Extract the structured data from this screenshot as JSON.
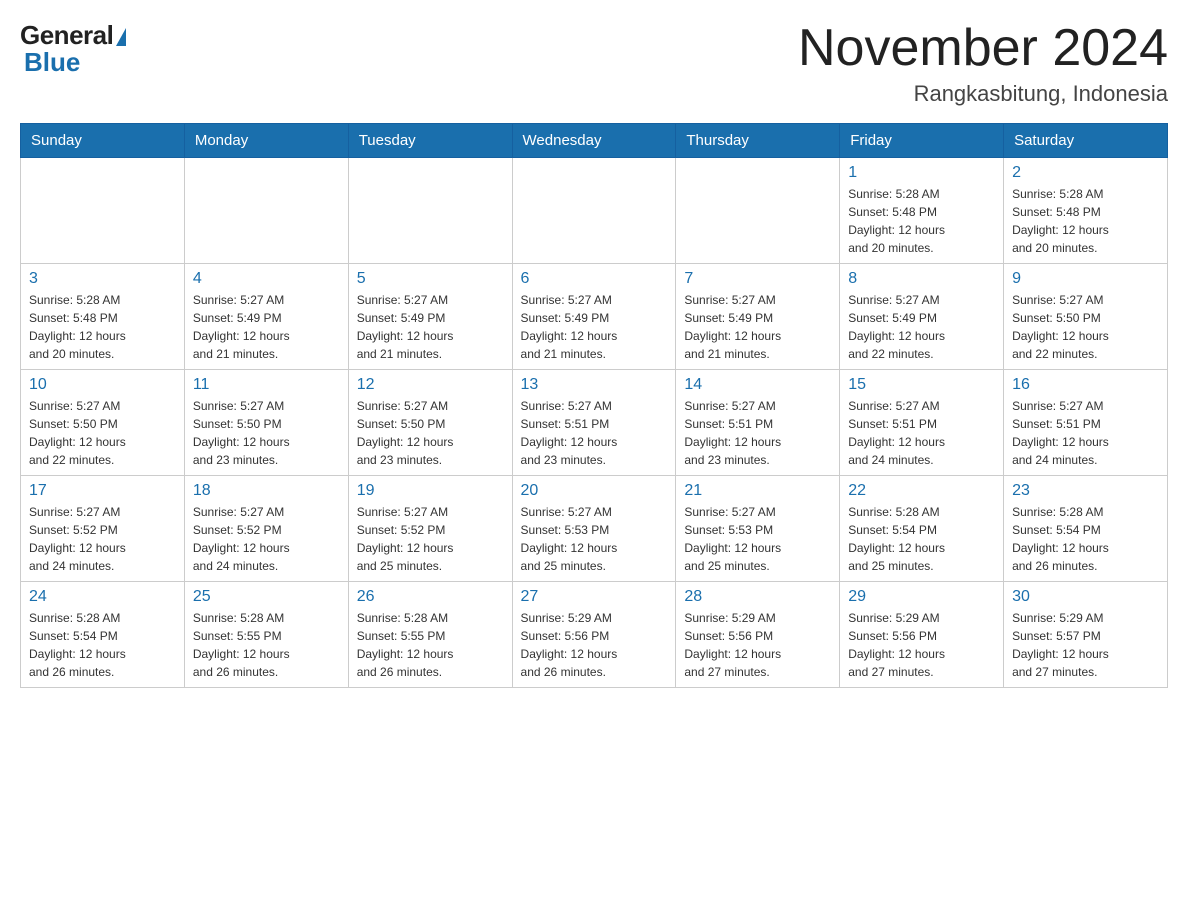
{
  "logo": {
    "general_text": "General",
    "blue_text": "Blue",
    "underline": "Blue"
  },
  "header": {
    "month_year": "November 2024",
    "location": "Rangkasbitung, Indonesia"
  },
  "weekdays": [
    "Sunday",
    "Monday",
    "Tuesday",
    "Wednesday",
    "Thursday",
    "Friday",
    "Saturday"
  ],
  "weeks": [
    [
      {
        "day": "",
        "info": ""
      },
      {
        "day": "",
        "info": ""
      },
      {
        "day": "",
        "info": ""
      },
      {
        "day": "",
        "info": ""
      },
      {
        "day": "",
        "info": ""
      },
      {
        "day": "1",
        "info": "Sunrise: 5:28 AM\nSunset: 5:48 PM\nDaylight: 12 hours\nand 20 minutes."
      },
      {
        "day": "2",
        "info": "Sunrise: 5:28 AM\nSunset: 5:48 PM\nDaylight: 12 hours\nand 20 minutes."
      }
    ],
    [
      {
        "day": "3",
        "info": "Sunrise: 5:28 AM\nSunset: 5:48 PM\nDaylight: 12 hours\nand 20 minutes."
      },
      {
        "day": "4",
        "info": "Sunrise: 5:27 AM\nSunset: 5:49 PM\nDaylight: 12 hours\nand 21 minutes."
      },
      {
        "day": "5",
        "info": "Sunrise: 5:27 AM\nSunset: 5:49 PM\nDaylight: 12 hours\nand 21 minutes."
      },
      {
        "day": "6",
        "info": "Sunrise: 5:27 AM\nSunset: 5:49 PM\nDaylight: 12 hours\nand 21 minutes."
      },
      {
        "day": "7",
        "info": "Sunrise: 5:27 AM\nSunset: 5:49 PM\nDaylight: 12 hours\nand 21 minutes."
      },
      {
        "day": "8",
        "info": "Sunrise: 5:27 AM\nSunset: 5:49 PM\nDaylight: 12 hours\nand 22 minutes."
      },
      {
        "day": "9",
        "info": "Sunrise: 5:27 AM\nSunset: 5:50 PM\nDaylight: 12 hours\nand 22 minutes."
      }
    ],
    [
      {
        "day": "10",
        "info": "Sunrise: 5:27 AM\nSunset: 5:50 PM\nDaylight: 12 hours\nand 22 minutes."
      },
      {
        "day": "11",
        "info": "Sunrise: 5:27 AM\nSunset: 5:50 PM\nDaylight: 12 hours\nand 23 minutes."
      },
      {
        "day": "12",
        "info": "Sunrise: 5:27 AM\nSunset: 5:50 PM\nDaylight: 12 hours\nand 23 minutes."
      },
      {
        "day": "13",
        "info": "Sunrise: 5:27 AM\nSunset: 5:51 PM\nDaylight: 12 hours\nand 23 minutes."
      },
      {
        "day": "14",
        "info": "Sunrise: 5:27 AM\nSunset: 5:51 PM\nDaylight: 12 hours\nand 23 minutes."
      },
      {
        "day": "15",
        "info": "Sunrise: 5:27 AM\nSunset: 5:51 PM\nDaylight: 12 hours\nand 24 minutes."
      },
      {
        "day": "16",
        "info": "Sunrise: 5:27 AM\nSunset: 5:51 PM\nDaylight: 12 hours\nand 24 minutes."
      }
    ],
    [
      {
        "day": "17",
        "info": "Sunrise: 5:27 AM\nSunset: 5:52 PM\nDaylight: 12 hours\nand 24 minutes."
      },
      {
        "day": "18",
        "info": "Sunrise: 5:27 AM\nSunset: 5:52 PM\nDaylight: 12 hours\nand 24 minutes."
      },
      {
        "day": "19",
        "info": "Sunrise: 5:27 AM\nSunset: 5:52 PM\nDaylight: 12 hours\nand 25 minutes."
      },
      {
        "day": "20",
        "info": "Sunrise: 5:27 AM\nSunset: 5:53 PM\nDaylight: 12 hours\nand 25 minutes."
      },
      {
        "day": "21",
        "info": "Sunrise: 5:27 AM\nSunset: 5:53 PM\nDaylight: 12 hours\nand 25 minutes."
      },
      {
        "day": "22",
        "info": "Sunrise: 5:28 AM\nSunset: 5:54 PM\nDaylight: 12 hours\nand 25 minutes."
      },
      {
        "day": "23",
        "info": "Sunrise: 5:28 AM\nSunset: 5:54 PM\nDaylight: 12 hours\nand 26 minutes."
      }
    ],
    [
      {
        "day": "24",
        "info": "Sunrise: 5:28 AM\nSunset: 5:54 PM\nDaylight: 12 hours\nand 26 minutes."
      },
      {
        "day": "25",
        "info": "Sunrise: 5:28 AM\nSunset: 5:55 PM\nDaylight: 12 hours\nand 26 minutes."
      },
      {
        "day": "26",
        "info": "Sunrise: 5:28 AM\nSunset: 5:55 PM\nDaylight: 12 hours\nand 26 minutes."
      },
      {
        "day": "27",
        "info": "Sunrise: 5:29 AM\nSunset: 5:56 PM\nDaylight: 12 hours\nand 26 minutes."
      },
      {
        "day": "28",
        "info": "Sunrise: 5:29 AM\nSunset: 5:56 PM\nDaylight: 12 hours\nand 27 minutes."
      },
      {
        "day": "29",
        "info": "Sunrise: 5:29 AM\nSunset: 5:56 PM\nDaylight: 12 hours\nand 27 minutes."
      },
      {
        "day": "30",
        "info": "Sunrise: 5:29 AM\nSunset: 5:57 PM\nDaylight: 12 hours\nand 27 minutes."
      }
    ]
  ]
}
